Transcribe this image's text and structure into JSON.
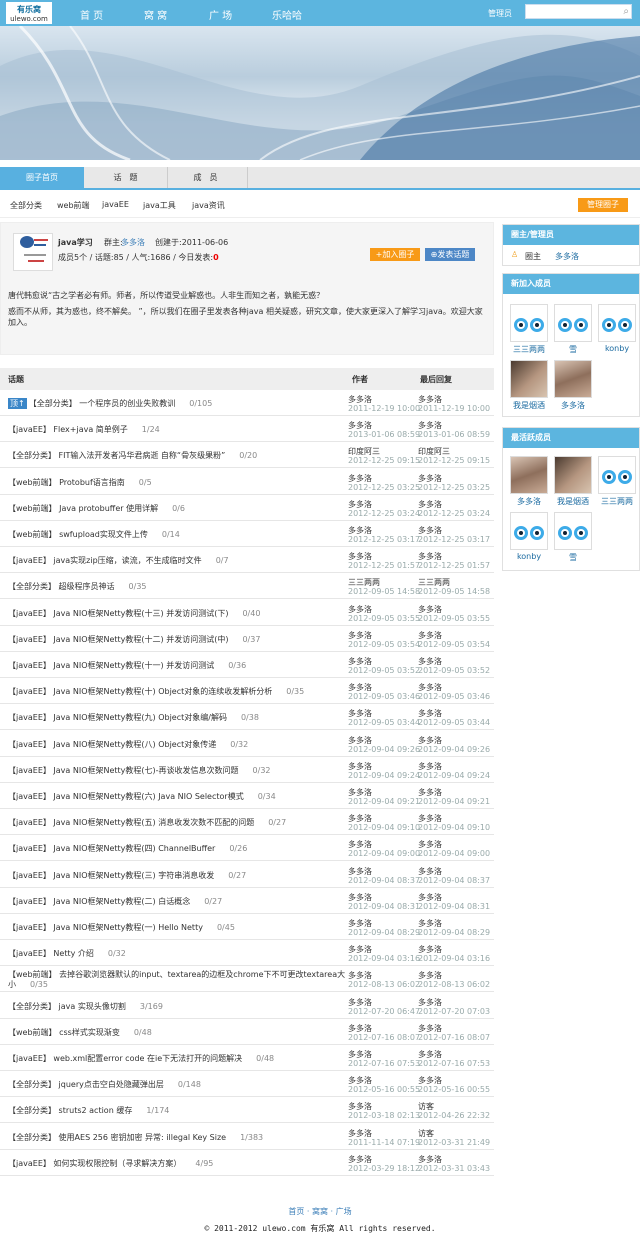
{
  "header": {
    "logo_main": "有乐窝",
    "logo_sub": "ulewo.com",
    "nav": [
      "首 页",
      "窝 窝",
      "广 场",
      "乐哈哈"
    ],
    "admin": "管理员"
  },
  "tabs": [
    "圈子首页",
    "话　题",
    "成　员"
  ],
  "categories": [
    "全部分类",
    "web前端",
    "javaEE",
    "java工具",
    "java资讯"
  ],
  "manage_button": "管理圈子",
  "group": {
    "name": "java学习",
    "owner_label": "群主:",
    "owner": "多多洛",
    "created": "创建于:2011-06-06",
    "stats": "成员5个 / 话题:85 / 人气:1686 / 今日发表:",
    "today": "0",
    "join": "+加入圈子",
    "post": "⊕发表话题",
    "desc1": "唐代韩愈说“古之学者必有师。师者，所以传道受业解惑也。人非生而知之者，孰能无惑？",
    "desc2": "惑而不从师，其为惑也，终不解矣。 ”，所以我们在圈子里发表各种java 相关疑惑，研究文章，使大家更深入了解学习java。欢迎大家加入。"
  },
  "table": {
    "header": [
      "话题",
      "作者",
      "最后回复"
    ],
    "rows": [
      {
        "pin": "顶↑",
        "cat": "【全部分类】",
        "title": "一个程序员的创业失败教训",
        "count": "0/105",
        "author": "多多洛",
        "adate": "2011-12-19 10:00",
        "last": "多多洛",
        "ldate": "2011-12-19 10:00"
      },
      {
        "cat": "【javaEE】",
        "title": "Flex+java 简单例子",
        "count": "1/24",
        "author": "多多洛",
        "adate": "2013-01-06 08:59",
        "last": "多多洛",
        "ldate": "2013-01-06 08:59"
      },
      {
        "cat": "【全部分类】",
        "title": "FIT输入法开发者冯华君病逝 自称“骨灰级果粉”",
        "count": "0/20",
        "author": "印度阿三",
        "adate": "2012-12-25 09:15",
        "last": "印度阿三",
        "ldate": "2012-12-25 09:15"
      },
      {
        "cat": "【web前端】",
        "title": "Protobuf语言指南",
        "count": "0/5",
        "author": "多多洛",
        "adate": "2012-12-25 03:25",
        "last": "多多洛",
        "ldate": "2012-12-25 03:25"
      },
      {
        "cat": "【web前端】",
        "title": "Java protobuffer 使用详解",
        "count": "0/6",
        "author": "多多洛",
        "adate": "2012-12-25 03:24",
        "last": "多多洛",
        "ldate": "2012-12-25 03:24"
      },
      {
        "cat": "【web前端】",
        "title": "swfupload实现文件上传",
        "count": "0/14",
        "author": "多多洛",
        "adate": "2012-12-25 03:17",
        "last": "多多洛",
        "ldate": "2012-12-25 03:17"
      },
      {
        "cat": "【javaEE】",
        "title": "java实现zip压缩，读流，不生成临时文件",
        "count": "0/7",
        "author": "多多洛",
        "adate": "2012-12-25 01:57",
        "last": "多多洛",
        "ldate": "2012-12-25 01:57"
      },
      {
        "cat": "【全部分类】",
        "title": "超级程序员神话",
        "count": "0/35",
        "author": "三三两两",
        "adate": "2012-09-05 14:58",
        "last": "三三两两",
        "ldate": "2012-09-05 14:58"
      },
      {
        "cat": "【javaEE】",
        "title": "Java NIO框架Netty教程(十三) 并发访问测试(下)",
        "count": "0/40",
        "author": "多多洛",
        "adate": "2012-09-05 03:55",
        "last": "多多洛",
        "ldate": "2012-09-05 03:55"
      },
      {
        "cat": "【javaEE】",
        "title": "Java NIO框架Netty教程(十二) 并发访问测试(中)",
        "count": "0/37",
        "author": "多多洛",
        "adate": "2012-09-05 03:54",
        "last": "多多洛",
        "ldate": "2012-09-05 03:54"
      },
      {
        "cat": "【javaEE】",
        "title": "Java NIO框架Netty教程(十一) 并发访问测试",
        "count": "0/36",
        "author": "多多洛",
        "adate": "2012-09-05 03:52",
        "last": "多多洛",
        "ldate": "2012-09-05 03:52"
      },
      {
        "cat": "【javaEE】",
        "title": "Java NIO框架Netty教程(十) Object对象的连续收发解析分析",
        "count": "0/35",
        "author": "多多洛",
        "adate": "2012-09-05 03:46",
        "last": "多多洛",
        "ldate": "2012-09-05 03:46"
      },
      {
        "cat": "【javaEE】",
        "title": "Java NIO框架Netty教程(九) Object对象编/解码",
        "count": "0/38",
        "author": "多多洛",
        "adate": "2012-09-05 03:44",
        "last": "多多洛",
        "ldate": "2012-09-05 03:44"
      },
      {
        "cat": "【javaEE】",
        "title": "Java NIO框架Netty教程(八) Object对象传递",
        "count": "0/32",
        "author": "多多洛",
        "adate": "2012-09-04 09:26",
        "last": "多多洛",
        "ldate": "2012-09-04 09:26"
      },
      {
        "cat": "【javaEE】",
        "title": "Java NIO框架Netty教程(七)-再谈收发信息次数问题",
        "count": "0/32",
        "author": "多多洛",
        "adate": "2012-09-04 09:24",
        "last": "多多洛",
        "ldate": "2012-09-04 09:24"
      },
      {
        "cat": "【javaEE】",
        "title": "Java NIO框架Netty教程(六) Java NIO Selector模式",
        "count": "0/34",
        "author": "多多洛",
        "adate": "2012-09-04 09:21",
        "last": "多多洛",
        "ldate": "2012-09-04 09:21"
      },
      {
        "cat": "【javaEE】",
        "title": "Java NIO框架Netty教程(五) 消息收发次数不匹配的问题",
        "count": "0/27",
        "author": "多多洛",
        "adate": "2012-09-04 09:10",
        "last": "多多洛",
        "ldate": "2012-09-04 09:10"
      },
      {
        "cat": "【javaEE】",
        "title": "Java NIO框架Netty教程(四) ChannelBuffer",
        "count": "0/26",
        "author": "多多洛",
        "adate": "2012-09-04 09:00",
        "last": "多多洛",
        "ldate": "2012-09-04 09:00"
      },
      {
        "cat": "【javaEE】",
        "title": "Java NIO框架Netty教程(三) 字符串消息收发",
        "count": "0/27",
        "author": "多多洛",
        "adate": "2012-09-04 08:37",
        "last": "多多洛",
        "ldate": "2012-09-04 08:37"
      },
      {
        "cat": "【javaEE】",
        "title": "Java NIO框架Netty教程(二) 白话概念",
        "count": "0/27",
        "author": "多多洛",
        "adate": "2012-09-04 08:31",
        "last": "多多洛",
        "ldate": "2012-09-04 08:31"
      },
      {
        "cat": "【javaEE】",
        "title": "Java NIO框架Netty教程(一) Hello Netty",
        "count": "0/45",
        "author": "多多洛",
        "adate": "2012-09-04 08:29",
        "last": "多多洛",
        "ldate": "2012-09-04 08:29"
      },
      {
        "cat": "【javaEE】",
        "title": "Netty 介绍",
        "count": "0/32",
        "author": "多多洛",
        "adate": "2012-09-04 03:16",
        "last": "多多洛",
        "ldate": "2012-09-04 03:16"
      },
      {
        "cat": "【web前端】",
        "title": "去掉谷歌浏览器默认的input、textarea的边框及chrome下不可更改textarea大小",
        "count": "0/35",
        "author": "多多洛",
        "adate": "2012-08-13 06:02",
        "last": "多多洛",
        "ldate": "2012-08-13 06:02"
      },
      {
        "cat": "【全部分类】",
        "title": "java 实现头像切割",
        "count": "3/169",
        "author": "多多洛",
        "adate": "2012-07-20 06:47",
        "last": "多多洛",
        "ldate": "2012-07-20 07:03"
      },
      {
        "cat": "【web前端】",
        "title": "css样式实现渐变",
        "count": "0/48",
        "author": "多多洛",
        "adate": "2012-07-16 08:07",
        "last": "多多洛",
        "ldate": "2012-07-16 08:07"
      },
      {
        "cat": "【javaEE】",
        "title": "web.xml配置error code 在ie下无法打开的问题解决",
        "count": "0/48",
        "author": "多多洛",
        "adate": "2012-07-16 07:53",
        "last": "多多洛",
        "ldate": "2012-07-16 07:53"
      },
      {
        "cat": "【全部分类】",
        "title": "jquery点击空白处隐藏弹出层",
        "count": "0/148",
        "author": "多多洛",
        "adate": "2012-05-16 00:55",
        "last": "多多洛",
        "ldate": "2012-05-16 00:55"
      },
      {
        "cat": "【全部分类】",
        "title": "struts2 action 缓存",
        "count": "1/174",
        "author": "多多洛",
        "adate": "2012-03-18 02:13",
        "last": "访客",
        "ldate": "2012-04-26 22:32"
      },
      {
        "cat": "【全部分类】",
        "title": "使用AES 256 密钥加密 异常: illegal Key Size",
        "count": "1/383",
        "author": "多多洛",
        "adate": "2011-11-14 07:19",
        "last": "访客",
        "ldate": "2012-03-31 21:49"
      },
      {
        "cat": "【javaEE】",
        "title": "如何实现权限控制（寻求解决方案）",
        "count": "4/95",
        "author": "多多洛",
        "adate": "2012-03-29 18:12",
        "last": "多多洛",
        "ldate": "2012-03-31 03:43"
      }
    ]
  },
  "sidebar": {
    "admins_title": "圈主/管理员",
    "owner_label": "圈主",
    "owner_name": "多多洛",
    "new_title": "新加入成员",
    "new_members": [
      "三三两两",
      "雪",
      "konby",
      "我是烟酒",
      "多多洛"
    ],
    "active_title": "最活跃成员",
    "active_members": [
      "多多洛",
      "我是烟酒",
      "三三两两",
      "konby",
      "雪"
    ]
  },
  "footer": {
    "links": "首页 · 窝窝 · 广场",
    "copyright": "© 2011-2012  ulewo.com 有乐窝 All rights reserved."
  }
}
